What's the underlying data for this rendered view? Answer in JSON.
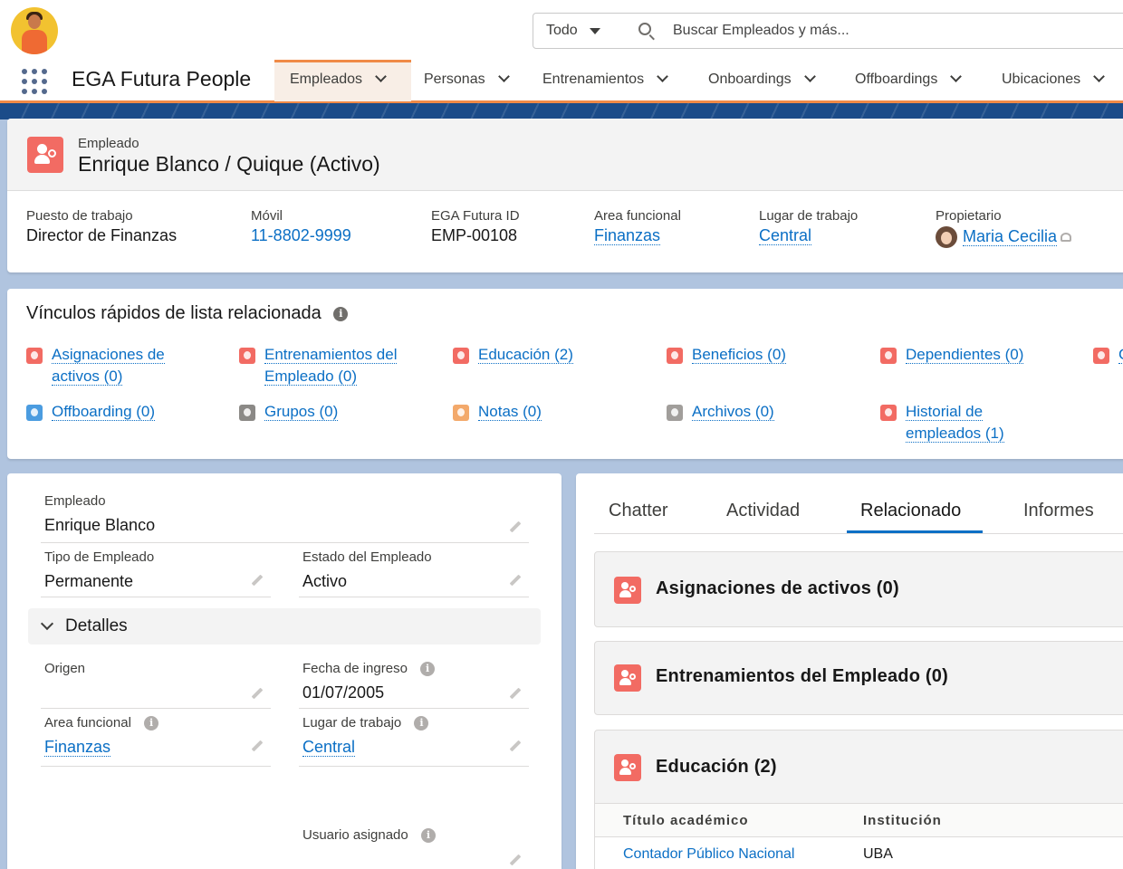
{
  "header": {
    "search_scope": "Todo",
    "search_placeholder": "Buscar Empleados y más..."
  },
  "nav": {
    "app_name": "EGA Futura People",
    "tabs": [
      {
        "label": "Empleados",
        "active": true
      },
      {
        "label": "Personas"
      },
      {
        "label": "Entrenamientos"
      },
      {
        "label": "Onboardings"
      },
      {
        "label": "Offboardings"
      },
      {
        "label": "Ubicaciones"
      }
    ]
  },
  "record": {
    "object_label": "Empleado",
    "title": "Enrique Blanco / Quique (Activo)",
    "highlights": [
      {
        "label": "Puesto de trabajo",
        "value": "Director de Finanzas"
      },
      {
        "label": "Móvil",
        "value": "11-8802-9999"
      },
      {
        "label": "EGA Futura ID",
        "value": "EMP-00108"
      },
      {
        "label": "Area funcional",
        "value": "Finanzas"
      },
      {
        "label": "Lugar de trabajo",
        "value": "Central"
      },
      {
        "label": "Propietario",
        "value": "Maria Cecilia"
      }
    ]
  },
  "quick_links": {
    "title": "Vínculos rápidos de lista relacionada",
    "items": [
      {
        "label": "Asignaciones de activos (0)",
        "color": "#f26b63"
      },
      {
        "label": "Entrenamientos del Empleado (0)",
        "color": "#f26b63"
      },
      {
        "label": "Educación (2)",
        "color": "#f26b63"
      },
      {
        "label": "Beneficios (0)",
        "color": "#f26b63"
      },
      {
        "label": "Dependientes (0)",
        "color": "#f26b63"
      },
      {
        "label": "C",
        "color": "#f26b63"
      },
      {
        "label": "Offboarding (0)",
        "color": "#4b9ce0"
      },
      {
        "label": "Grupos (0)",
        "color": "#8b8986"
      },
      {
        "label": "Notas (0)",
        "color": "#f3a96b"
      },
      {
        "label": "Archivos (0)",
        "color": "#a19e9b"
      },
      {
        "label": "Historial de empleados (1)",
        "color": "#f26b63"
      }
    ]
  },
  "details": {
    "employee_label": "Empleado",
    "employee_value": "Enrique Blanco",
    "tipo_label": "Tipo de Empleado",
    "tipo_value": "Permanente",
    "estado_label": "Estado del Empleado",
    "estado_value": "Activo",
    "section_title": "Detalles",
    "origen_label": "Origen",
    "origen_value": "",
    "fecha_label": "Fecha de ingreso",
    "fecha_value": "01/07/2005",
    "area_label": "Area funcional",
    "area_value": "Finanzas",
    "lugar_label": "Lugar de trabajo",
    "lugar_value": "Central",
    "usuario_label": "Usuario asignado",
    "info_glyph": "i"
  },
  "related": {
    "tabs": [
      "Chatter",
      "Actividad",
      "Relacionado",
      "Informes"
    ],
    "active_tab": "Relacionado",
    "panels": [
      {
        "title": "Asignaciones de activos (0)"
      },
      {
        "title": "Entrenamientos del Empleado (0)"
      },
      {
        "title": "Educación (2)"
      }
    ],
    "edu_columns": [
      "Título académico",
      "Institución"
    ],
    "edu_rows": [
      {
        "titulo": "Contador Público Nacional",
        "institucion": "UBA"
      }
    ]
  }
}
